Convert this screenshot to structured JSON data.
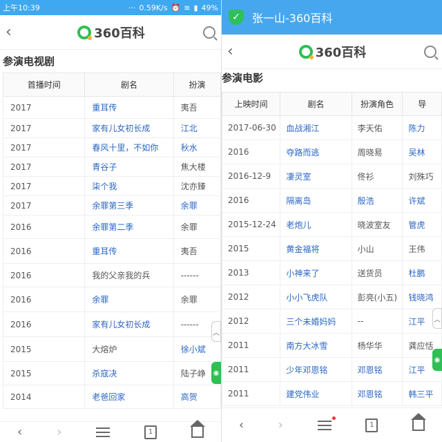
{
  "status": {
    "time": "上午10:39",
    "speed": "0.59K/s",
    "battery": "49%"
  },
  "left": {
    "logo_text": "360百科",
    "section_title": "参演电视剧",
    "headers": [
      "首播时间",
      "剧名",
      "扮演"
    ],
    "rows": [
      [
        "2017",
        "重耳传",
        "夷吾",
        true,
        false
      ],
      [
        "2017",
        "家有儿女初长成",
        "江北",
        true,
        true
      ],
      [
        "2017",
        "春风十里，不如你",
        "秋水",
        true,
        true
      ],
      [
        "2017",
        "青谷子",
        "焦大楼",
        true,
        false
      ],
      [
        "2017",
        "柒个我",
        "沈亦臻",
        true,
        false
      ],
      [
        "2017",
        "余罪第三季",
        "余罪",
        true,
        true
      ],
      [
        "2016",
        "余罪第二季",
        "余罪",
        true,
        false
      ],
      [
        "2016",
        "重耳传",
        "夷吾",
        true,
        false
      ],
      [
        "2016",
        "我的父亲我的兵",
        "------",
        false,
        false
      ],
      [
        "2016",
        "余罪",
        "余罪",
        true,
        false
      ],
      [
        "2016",
        "家有儿女初长成",
        "------",
        true,
        false
      ],
      [
        "2015",
        "大熔炉",
        "徐小斌",
        false,
        true
      ],
      [
        "2015",
        "杀寇决",
        "陆子峥",
        true,
        false
      ],
      [
        "2014",
        "老爸回家",
        "高贺",
        true,
        true
      ]
    ],
    "tab_count": "1"
  },
  "right": {
    "window_title": "张一山-360百科",
    "logo_text": "360百科",
    "section_title": "参演电影",
    "headers": [
      "上映时间",
      "剧名",
      "扮演角色",
      "导"
    ],
    "rows": [
      [
        "2017-06-30",
        "血战湘江",
        "李天佑",
        "陈力",
        true
      ],
      [
        "2016",
        "夺路而逃",
        "周晓易",
        "吴林",
        true
      ],
      [
        "2016-12-9",
        "凄灵室",
        "佟衫",
        "刘殊巧",
        false
      ],
      [
        "2016",
        "隔离岛",
        "殷浩",
        "许斌",
        true
      ],
      [
        "2015-12-24",
        "老炮儿",
        "晓波室友",
        "管虎",
        true
      ],
      [
        "2015",
        "黄金福将",
        "小山",
        "王伟",
        false
      ],
      [
        "2013",
        "小神来了",
        "送货员",
        "杜鹏",
        true
      ],
      [
        "2012",
        "小小飞虎队",
        "彭亮(小五)",
        "钱晓鸿",
        true
      ],
      [
        "2012",
        "三个未婚妈妈",
        "--",
        "江平",
        true
      ],
      [
        "2011",
        "南方大冰雪",
        "杨华华",
        "龚应恬",
        false
      ],
      [
        "2011",
        "少年邓恩铭",
        "邓恩铭",
        "江平",
        true
      ],
      [
        "2011",
        "建党伟业",
        "邓恩铭",
        "韩三平",
        true
      ]
    ],
    "tab_count": "1"
  },
  "chart_data": [
    {
      "type": "table",
      "title": "参演电视剧",
      "columns": [
        "首播时间",
        "剧名",
        "扮演"
      ],
      "rows": [
        [
          "2017",
          "重耳传",
          "夷吾"
        ],
        [
          "2017",
          "家有儿女初长成",
          "江北"
        ],
        [
          "2017",
          "春风十里，不如你",
          "秋水"
        ],
        [
          "2017",
          "青谷子",
          "焦大楼"
        ],
        [
          "2017",
          "柒个我",
          "沈亦臻"
        ],
        [
          "2017",
          "余罪第三季",
          "余罪"
        ],
        [
          "2016",
          "余罪第二季",
          "余罪"
        ],
        [
          "2016",
          "重耳传",
          "夷吾"
        ],
        [
          "2016",
          "我的父亲我的兵",
          "------"
        ],
        [
          "2016",
          "余罪",
          "余罪"
        ],
        [
          "2016",
          "家有儿女初长成",
          "------"
        ],
        [
          "2015",
          "大熔炉",
          "徐小斌"
        ],
        [
          "2015",
          "杀寇决",
          "陆子峥"
        ],
        [
          "2014",
          "老爸回家",
          "高贺"
        ]
      ]
    },
    {
      "type": "table",
      "title": "参演电影",
      "columns": [
        "上映时间",
        "剧名",
        "扮演角色",
        "导"
      ],
      "rows": [
        [
          "2017-06-30",
          "血战湘江",
          "李天佑",
          "陈力"
        ],
        [
          "2016",
          "夺路而逃",
          "周晓易",
          "吴林"
        ],
        [
          "2016-12-9",
          "凄灵室",
          "佟衫",
          "刘殊巧"
        ],
        [
          "2016",
          "隔离岛",
          "殷浩",
          "许斌"
        ],
        [
          "2015-12-24",
          "老炮儿",
          "晓波室友",
          "管虎"
        ],
        [
          "2015",
          "黄金福将",
          "小山",
          "王伟"
        ],
        [
          "2013",
          "小神来了",
          "送货员",
          "杜鹏"
        ],
        [
          "2012",
          "小小飞虎队",
          "彭亮(小五)",
          "钱晓鸿"
        ],
        [
          "2012",
          "三个未婚妈妈",
          "--",
          "江平"
        ],
        [
          "2011",
          "南方大冰雪",
          "杨华华",
          "龚应恬"
        ],
        [
          "2011",
          "少年邓恩铭",
          "邓恩铭",
          "江平"
        ],
        [
          "2011",
          "建党伟业",
          "邓恩铭",
          "韩三平"
        ]
      ]
    }
  ]
}
